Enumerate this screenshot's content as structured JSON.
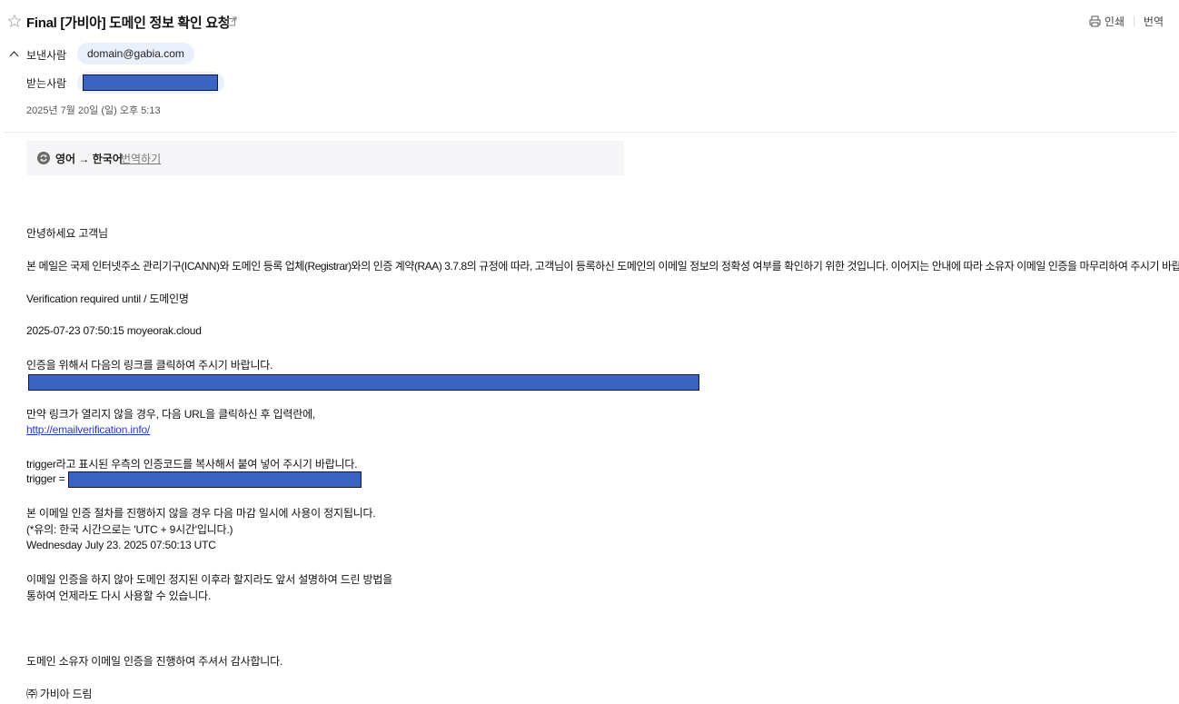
{
  "header": {
    "title": "Final [가비아] 도메인 정보 확인 요청",
    "print_label": "인쇄",
    "translate_label": "번역"
  },
  "meta": {
    "sender_label": "보낸사람",
    "sender_email": "domain@gabia.com",
    "recipient_label": "받는사람",
    "date": "2025년 7월 20일 (일) 오후 5:13"
  },
  "translation": {
    "languages": "영어 → 한국어",
    "action": "번역하기"
  },
  "body": {
    "greeting": "안녕하세요 고객님",
    "intro": "본 메일은 국제 인터넷주소 관리기구(ICANN)와 도메인 등록 업체(Registrar)와의 인증 계약(RAA) 3.7.8의 규정에 따라, 고객님이 등록하신 도메인의 이메일 정보의 정확성 여부를 확인하기 위한 것입니다. 이어지는 안내에 따라 소유자 이메일 인증을 마무리하여 주시기 바랍니다.",
    "verification_header": "Verification required until / 도메인명",
    "verification_value": "2025-07-23 07:50:15 moyeorak.cloud",
    "click_instruction": "인증을 위해서 다음의 링크를 클릭하여 주시기 바랍니다.",
    "fallback_instruction": "만약 링크가 열리지 않을 경우, 다음 URL을 클릭하신 후 입력란에,",
    "fallback_url": "http://emailverification.info/",
    "trigger_instruction": "trigger라고 표시된 우측의 인증코드를 복사해서 붙여 넣어 주시기 바랍니다.",
    "trigger_label": "trigger =",
    "suspend_notice": "본 이메일 인증 절차를 진행하지 않을 경우 다음 마감 일시에 사용이 정지됩니다.",
    "timezone_note": "(*유의: 한국 시간으로는 'UTC + 9시간'입니다.)",
    "deadline": "Wednesday July 23. 2025 07:50:13 UTC",
    "reactivate_1": "이메일 인증을 하지 않아 도메인 정지된 이후라 할지라도 앞서 설명하여 드린 방법을",
    "reactivate_2": "통하여 언제라도 다시 사용할 수 있습니다.",
    "thanks": "도메인 소유자 이메일 인증을 진행하여 주셔서 감사합니다.",
    "signature": "㈜ 가비아 드림"
  },
  "colors": {
    "link": "#1a3fd6",
    "redaction": "#3b63c4",
    "chip": "#eaf0fb"
  }
}
